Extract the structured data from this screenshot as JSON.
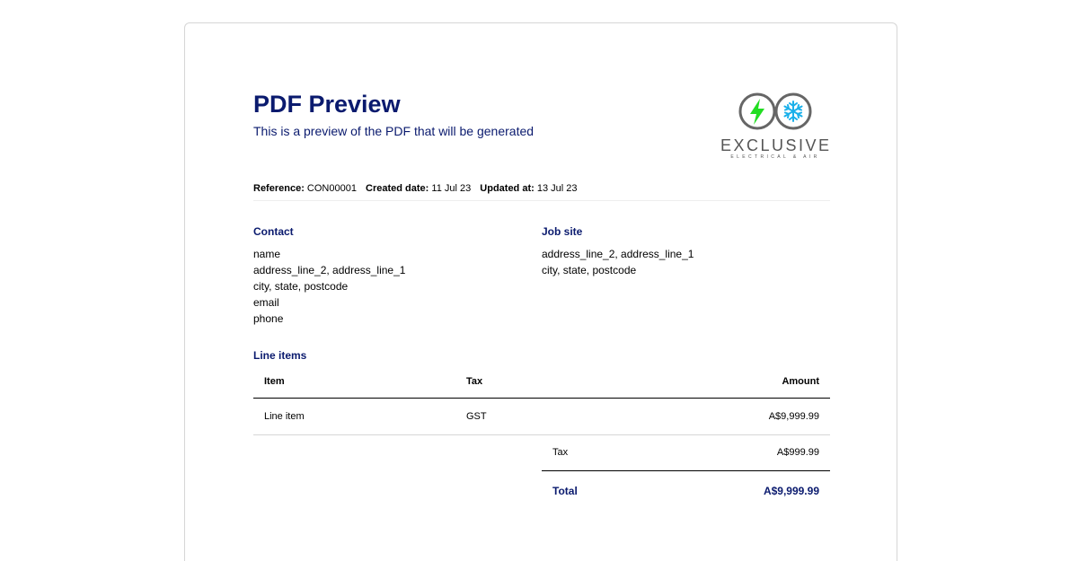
{
  "header": {
    "title": "PDF Preview",
    "subtitle": "This is a preview of the PDF that will be generated"
  },
  "logo": {
    "name": "EXCLUSIVE",
    "tagline": "ELECTRICAL & AIR",
    "icons": [
      "lightning-icon",
      "snowflake-icon"
    ],
    "colors": {
      "ring": "#666666",
      "bolt": "#22dd22",
      "snow": "#1ab0ea"
    }
  },
  "meta": {
    "reference_label": "Reference:",
    "reference": "CON00001",
    "created_label": "Created date:",
    "created": "11 Jul 23",
    "updated_label": "Updated at:",
    "updated": "13 Jul 23"
  },
  "contact": {
    "heading": "Contact",
    "lines": [
      "name",
      "address_line_2, address_line_1",
      "city, state, postcode",
      "email",
      "phone"
    ]
  },
  "job_site": {
    "heading": "Job site",
    "lines": [
      "address_line_2, address_line_1",
      "city, state, postcode"
    ]
  },
  "line_items": {
    "heading": "Line items",
    "columns": {
      "item": "Item",
      "tax": "Tax",
      "amount": "Amount"
    },
    "rows": [
      {
        "item": "Line item",
        "tax": "GST",
        "amount": "A$9,999.99"
      }
    ],
    "tax_label": "Tax",
    "tax_amount": "A$999.99",
    "total_label": "Total",
    "total_amount": "A$9,999.99"
  },
  "colors": {
    "accent": "#0a1a6e"
  }
}
